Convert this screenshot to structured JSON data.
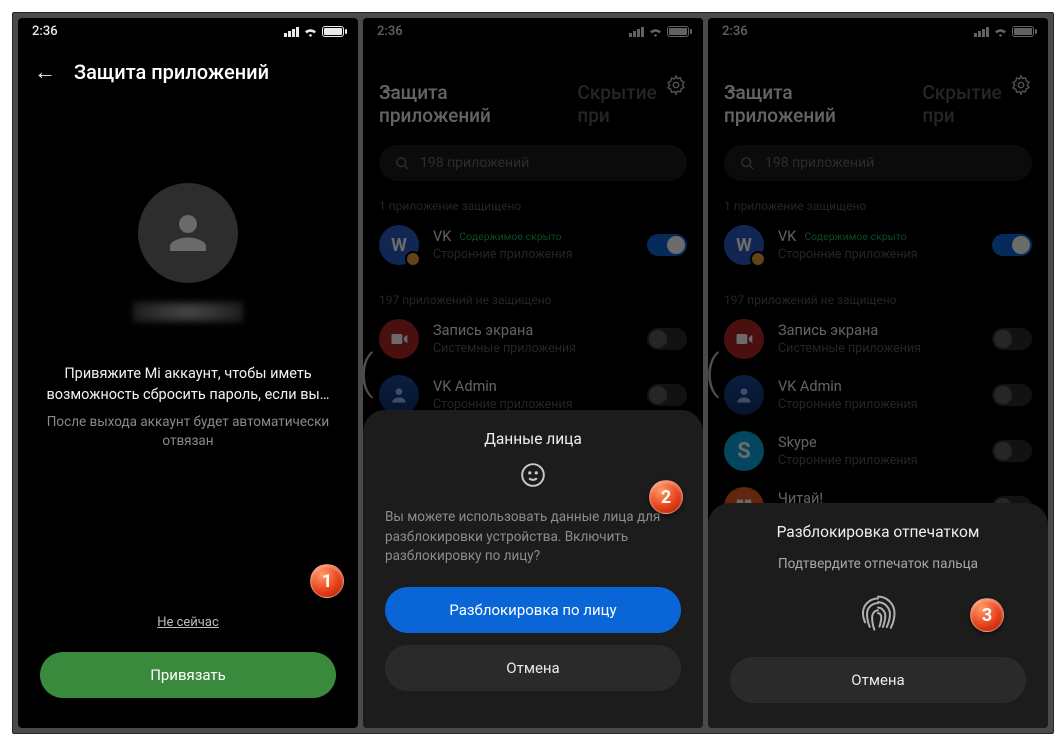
{
  "status": {
    "time": "2:36"
  },
  "screen1": {
    "title": "Защита приложений",
    "bind_title": "Привяжите Mi аккаунт, чтобы иметь возможность сбросить пароль, если вы…",
    "bind_sub": "После выхода аккаунт будет автоматически отвязан",
    "not_now": "Не сейчас",
    "bind_btn": "Привязать",
    "step": "1"
  },
  "list": {
    "tab_a": "Защита приложений",
    "tab_b": "Скрытие при",
    "search_placeholder": "198 приложений",
    "protected_label": "1 приложение защищено",
    "unprotected_label": "197 приложений не защищено",
    "vk_name": "VK",
    "vk_hidden": "Содержимое скрыто",
    "vk_admin_name": "VK Admin",
    "rec_name": "Запись экрана",
    "skype_name": "Skype",
    "chitai_name": "Читай!",
    "sub_third": "Сторонние приложения",
    "sub_system": "Системные приложения"
  },
  "sheet_face": {
    "title": "Данные лица",
    "body": "Вы можете использовать данные лица для разблокировки устройства. Включить разблокировку по лицу?",
    "primary": "Разблокировка по лицу",
    "cancel": "Отмена",
    "step": "2"
  },
  "sheet_fp": {
    "title": "Разблокировка отпечатком",
    "body": "Подтвердите отпечаток пальца",
    "cancel": "Отмена",
    "step": "3"
  }
}
